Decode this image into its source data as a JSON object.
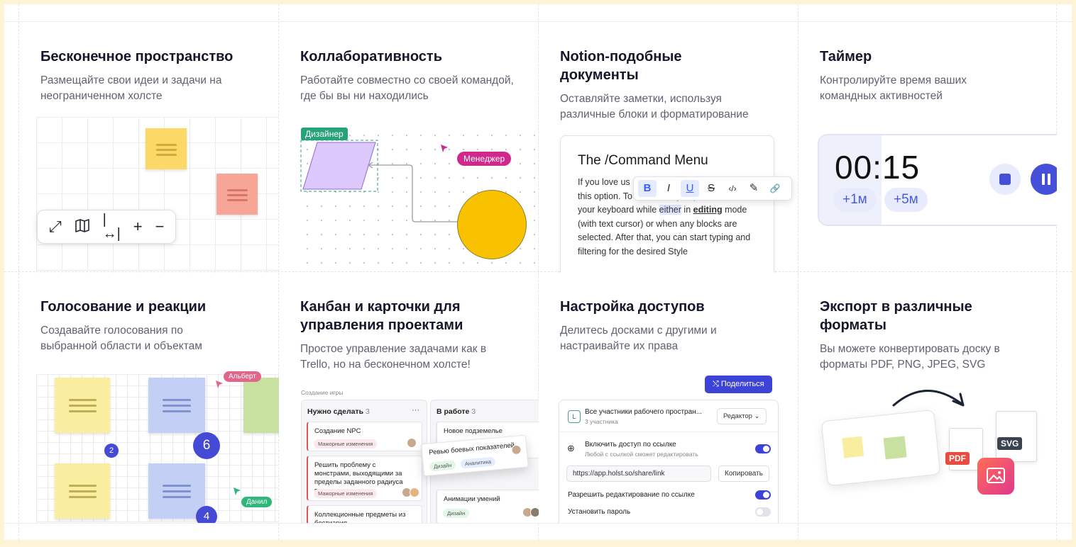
{
  "cards": {
    "c1": {
      "title": "Бесконечное пространство",
      "desc": "Размещайте свои идеи и задачи на неограниченном холсте"
    },
    "c2": {
      "title": "Коллаборативность",
      "desc": "Работайте совместно со своей командой, где бы вы ни находились",
      "tag_designer": "Дизайнер",
      "tag_manager": "Менеджер"
    },
    "c3": {
      "title": "Notion-подобные документы",
      "desc": "Оставляйте заметки, используя различные блоки и форматирование",
      "doc_title": "The /Command Menu",
      "doc_p1": "If you love us",
      "doc_p2": "this option. To activate it, just press / on",
      "doc_p3a": "your keyboard while ",
      "doc_p3b": "either",
      "doc_p3c": " in ",
      "doc_p3d": "editing",
      "doc_p3e": " mode",
      "doc_p4": "(with text cursor) or when any blocks are",
      "doc_p5": "selected. After that, you can start typing and",
      "doc_p6": "filtering for the desired Style",
      "fmt": {
        "b": "B",
        "i": "I",
        "u": "U",
        "s": "S",
        "code": "‹/›",
        "pen": "✎",
        "link": "🔗"
      }
    },
    "c4": {
      "title": "Таймер",
      "desc": "Контролируйте время ваших командных активностей",
      "time": "00:15",
      "plus1": "+1м",
      "plus5": "+5м"
    },
    "c5": {
      "title": "Голосование и реакции",
      "desc": "Создавайте голосования по выбранной области и объектам",
      "user1": "Альберт",
      "user2": "Данил",
      "vote_a": "2",
      "vote_b": "6",
      "vote_c": "4"
    },
    "c6": {
      "title": "Канбан и карточки для управления проектами",
      "desc": "Простое управление задачами как в Trello, но на бесконечном холсте!",
      "board": "Создание игры",
      "col1": {
        "name": "Нужно сделать",
        "count": "3",
        "menu": "···"
      },
      "col2": {
        "name": "В работе",
        "count": "3"
      },
      "card1": "Создание NPC",
      "tag_major": "Мажорные изменения",
      "card2": "Решить проблему с монстрами, выходящими за пределы заданного радиуса пути",
      "card3": "Коллекционные предметы из бестиария",
      "card4": "Новое подземелье",
      "card5": "Анимации умений",
      "drag_card": "Ревью боевых показателей",
      "tag_design": "Дизайн",
      "tag_analytics": "Аналитика"
    },
    "c7": {
      "title": "Настройка доступов",
      "desc": "Делитесь досками с другими и настраивайте их права",
      "share": "Поделиться",
      "ws_letter": "L",
      "ws_name": "Все участники рабочего простран...",
      "ws_count": "3 участника",
      "role": "Редактор",
      "link_on": "Включить доступ по ссылке",
      "link_sub": "Любой с ссылкой сможет редактировать",
      "url": "https://app.holst.so/share/link",
      "copy": "Копировать",
      "allow_edit": "Разрешить редактирование по ссылке",
      "password": "Установить пароль"
    },
    "c8": {
      "title": "Экспорт в различные форматы",
      "desc": "Вы можете конвертировать доску в форматы PDF, PNG, JPEG, SVG",
      "pdf": "PDF",
      "svg": "SVG"
    }
  }
}
